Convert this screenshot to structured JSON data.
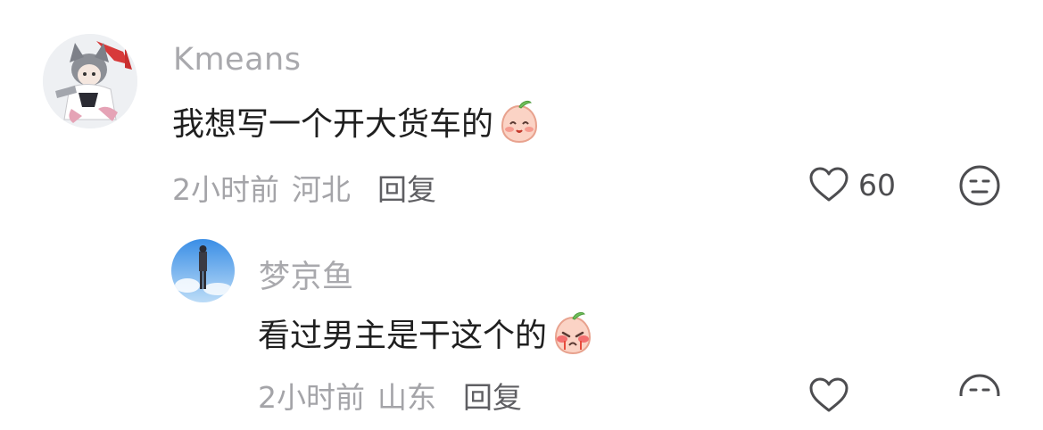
{
  "comments": [
    {
      "username": "Kmeans",
      "text": "我想写一个开大货车的",
      "emoji_icon": "smile-peach-icon",
      "time": "2小时前",
      "location": "河北",
      "reply_label": "回复",
      "like_count": "60",
      "avatar_icon": "anime-avatar-icon"
    },
    {
      "username": "梦京鱼",
      "text": "看过男主是干这个的",
      "emoji_icon": "crying-peach-icon",
      "time": "2小时前",
      "location": "山东",
      "reply_label": "回复",
      "like_count": "",
      "avatar_icon": "sky-photo-avatar-icon"
    }
  ],
  "colors": {
    "username": "#a9a9ad",
    "text": "#1f1f1f",
    "meta": "#a4a4a8",
    "reply": "#5f5f63",
    "icon_stroke": "#4d4d50"
  }
}
